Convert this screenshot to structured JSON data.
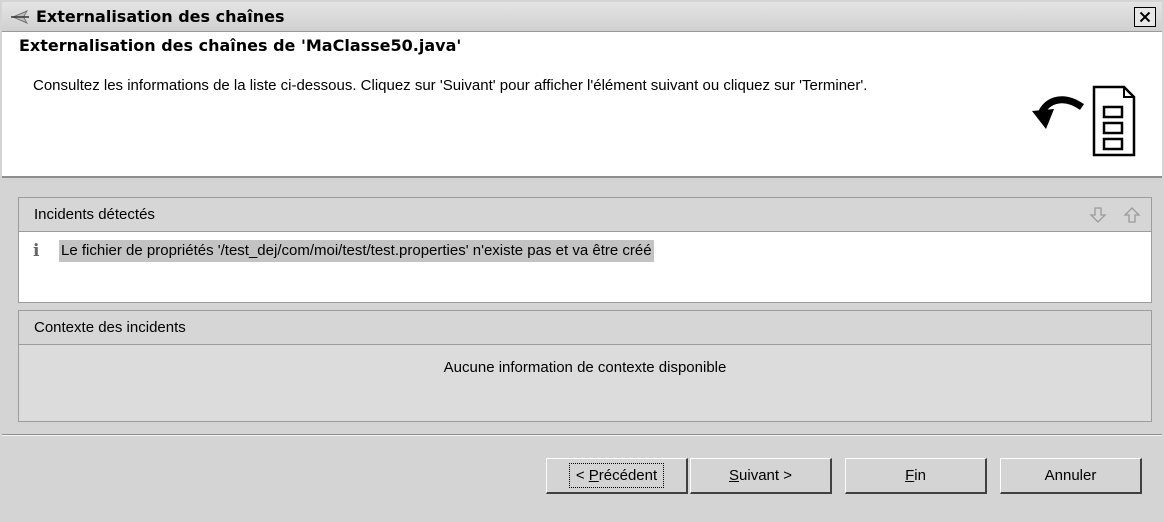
{
  "window": {
    "title": "Externalisation des chaînes",
    "close_label": "×"
  },
  "banner": {
    "title": "Externalisation des chaînes de 'MaClasse50.java'",
    "description": "Consultez les informations de la liste ci-dessous. Cliquez sur 'Suivant' pour afficher l'élément suivant ou cliquez sur 'Terminer'.",
    "icon": "externalize-strings-wizard-icon"
  },
  "incidents": {
    "header": "Incidents détectés",
    "items": [
      {
        "icon": "info-icon",
        "icon_glyph": "i",
        "text": "Le fichier de propriétés '/test_dej/com/moi/test/test.properties' n'existe pas et va être créé"
      }
    ]
  },
  "context": {
    "header": "Contexte des incidents",
    "message": "Aucune information de contexte disponible"
  },
  "buttons": {
    "previous": {
      "prefix": "< ",
      "mnemonic": "P",
      "rest": "récédent"
    },
    "next": {
      "mnemonic": "S",
      "rest": "uivant >"
    },
    "finish": {
      "mnemonic": "F",
      "rest": "in"
    },
    "cancel": {
      "label": "Annuler"
    }
  }
}
